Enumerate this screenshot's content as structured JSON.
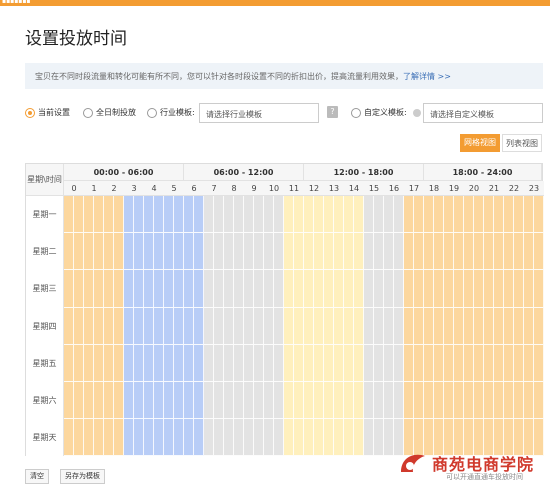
{
  "topbar": {
    "text": "▪▪▪▪▪▪▪"
  },
  "title": "设置投放时间",
  "notice": {
    "text": "宝贝在不同时段流量和转化可能有所不同，您可以针对各时段设置不同的折扣出价，提高流量利用效果，",
    "link": "了解详情 >>"
  },
  "options": {
    "current": "当前设置",
    "full_day": "全日制投放",
    "industry": "行业模板:",
    "industry_placeholder": "请选择行业模板",
    "custom": "自定义模板:",
    "custom_placeholder": "请选择自定义模板"
  },
  "views": {
    "grid": "网格视图",
    "list": "列表视图"
  },
  "schedule": {
    "corner": "星期\\时间",
    "ranges": [
      "00:00 - 06:00",
      "06:00 - 12:00",
      "12:00 - 18:00",
      "18:00 - 24:00"
    ],
    "hours": [
      "0",
      "1",
      "2",
      "3",
      "4",
      "5",
      "6",
      "7",
      "8",
      "9",
      "10",
      "11",
      "12",
      "13",
      "14",
      "15",
      "16",
      "17",
      "18",
      "19",
      "20",
      "21",
      "22",
      "23"
    ],
    "days": [
      "星期一",
      "星期二",
      "星期三",
      "星期四",
      "星期五",
      "星期六",
      "星期天"
    ],
    "hour_colors": [
      "#fcd79e",
      "#fcd79e",
      "#fcd79e",
      "#b8cdf7",
      "#b8cdf7",
      "#b8cdf7",
      "#b8cdf7",
      "#e3e3e3",
      "#e3e3e3",
      "#e3e3e3",
      "#e3e3e3",
      "#fff0bd",
      "#fff0bd",
      "#fff0bd",
      "#fff0bd",
      "#e3e3e3",
      "#e3e3e3",
      "#fcd79e",
      "#fcd79e",
      "#fcd79e",
      "#fcd79e",
      "#fcd79e",
      "#fcd79e",
      "#fcd79e"
    ]
  },
  "buttons": {
    "clear": "清空",
    "save_template": "另存为模板"
  },
  "watermark": {
    "brand": "商苑电商学院",
    "sub": "可以开通直通车投放时间"
  }
}
